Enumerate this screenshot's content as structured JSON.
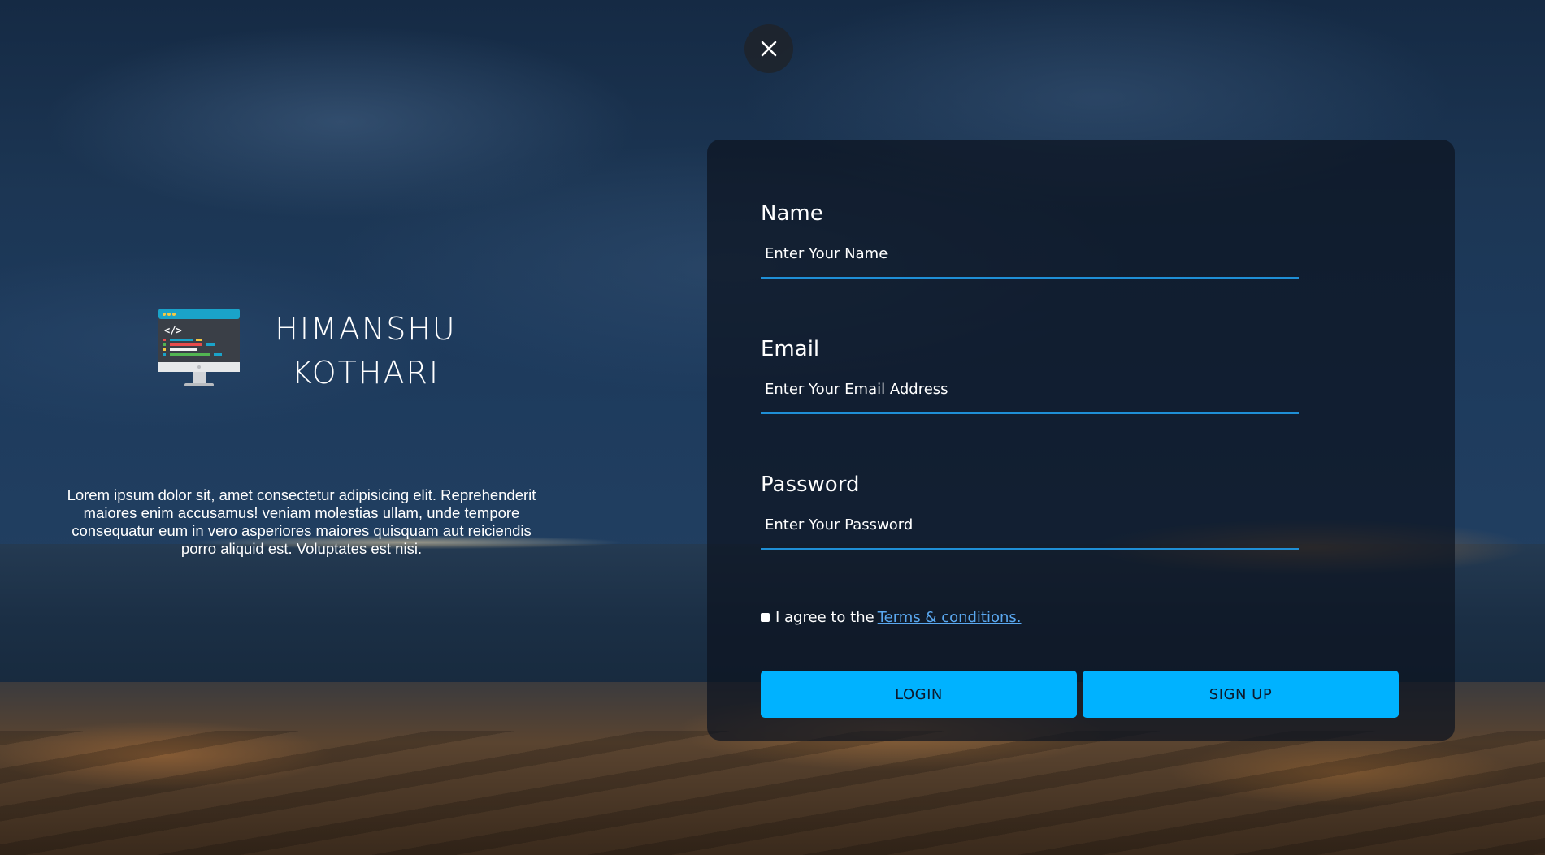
{
  "brand": {
    "name_line1": "HIMANSHU",
    "name_line2": "KOTHARI",
    "logo_icon": "monitor-code-icon",
    "tagline": "Lorem ipsum dolor sit, amet consectetur adipisicing elit. Reprehenderit maiores enim accusamus! veniam molestias ullam, unde tempore consequatur eum in vero asperiores maiores quisquam aut reiciendis porro aliquid est. Voluptates est nisi."
  },
  "close": {
    "icon": "close-icon"
  },
  "form": {
    "name": {
      "label": "Name",
      "placeholder": "Enter Your Name",
      "value": ""
    },
    "email": {
      "label": "Email",
      "placeholder": "Enter Your Email Address",
      "value": ""
    },
    "password": {
      "label": "Password",
      "placeholder": "Enter Your Password",
      "value": ""
    },
    "agree_text": "I agree to the",
    "terms_link": "Terms & conditions.",
    "login_label": "LOGIN",
    "signup_label": "SIGN UP"
  },
  "colors": {
    "accent": "#00b2ff",
    "input_underline": "#1f8fd6",
    "link": "#5aa8f0"
  }
}
